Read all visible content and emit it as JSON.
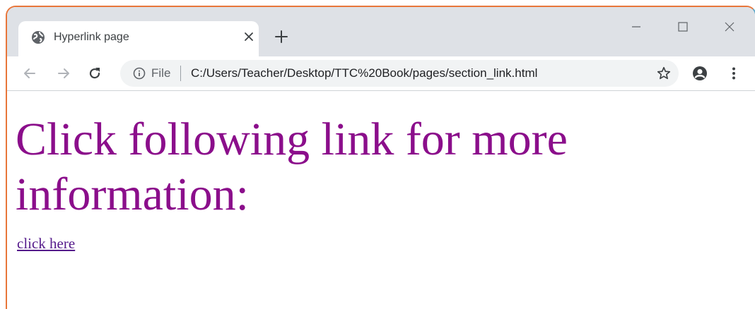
{
  "tab": {
    "title": "Hyperlink page",
    "icon": "globe-icon"
  },
  "toolbar": {
    "security_label": "File",
    "url": "C:/Users/Teacher/Desktop/TTC%20Book/pages/section_link.html"
  },
  "page": {
    "heading": "Click following link for more information:",
    "link_text": "click here"
  },
  "colors": {
    "heading": "#8b0e8b",
    "link": "#551a8b",
    "tabstrip": "#dee1e6",
    "omnibox": "#f1f3f4",
    "frame_left": "#e8763a",
    "frame_right": "#5aa6c8"
  }
}
